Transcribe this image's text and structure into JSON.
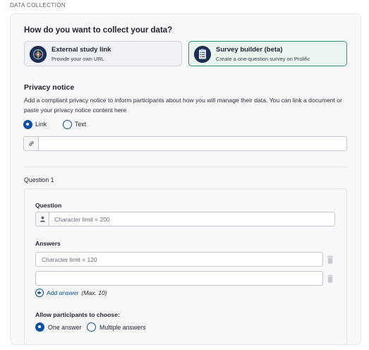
{
  "section_label": "DATA COLLECTION",
  "heading": "How do you want to collect your data?",
  "options": [
    {
      "title": "External study link",
      "subtitle": "Provide your own URL",
      "icon": "compass-icon",
      "selected": false
    },
    {
      "title": "Survey builder (beta)",
      "subtitle": "Create a one-question survey on Prolific",
      "icon": "clipboard-checklist-icon",
      "selected": true
    }
  ],
  "privacy": {
    "title": "Privacy notice",
    "description": "Add a compliant privacy notice to inform participants about how you will manage their data. You can link a document or paste your privacy notice content here",
    "radios": [
      {
        "label": "Link",
        "checked": true
      },
      {
        "label": "Text",
        "checked": false
      }
    ],
    "link_value": "",
    "link_icon": "link-icon"
  },
  "question": {
    "header": "Question 1",
    "question_label": "Question",
    "question_placeholder": "Character limit = 200",
    "answers_label": "Answers",
    "answers": [
      {
        "placeholder": "Character limit = 120",
        "value": ""
      },
      {
        "placeholder": "",
        "value": ""
      }
    ],
    "add_answer_label": "Add answer",
    "add_answer_max": "(Max. 10)",
    "choose_label": "Allow participants to choose:",
    "choose_options": [
      {
        "label": "One answer",
        "checked": true
      },
      {
        "label": "Multiple answers",
        "checked": false
      }
    ]
  },
  "colors": {
    "accent": "#0c4f9e",
    "selected_border": "#3a8f6f",
    "selected_bg": "#e9f4ef"
  }
}
